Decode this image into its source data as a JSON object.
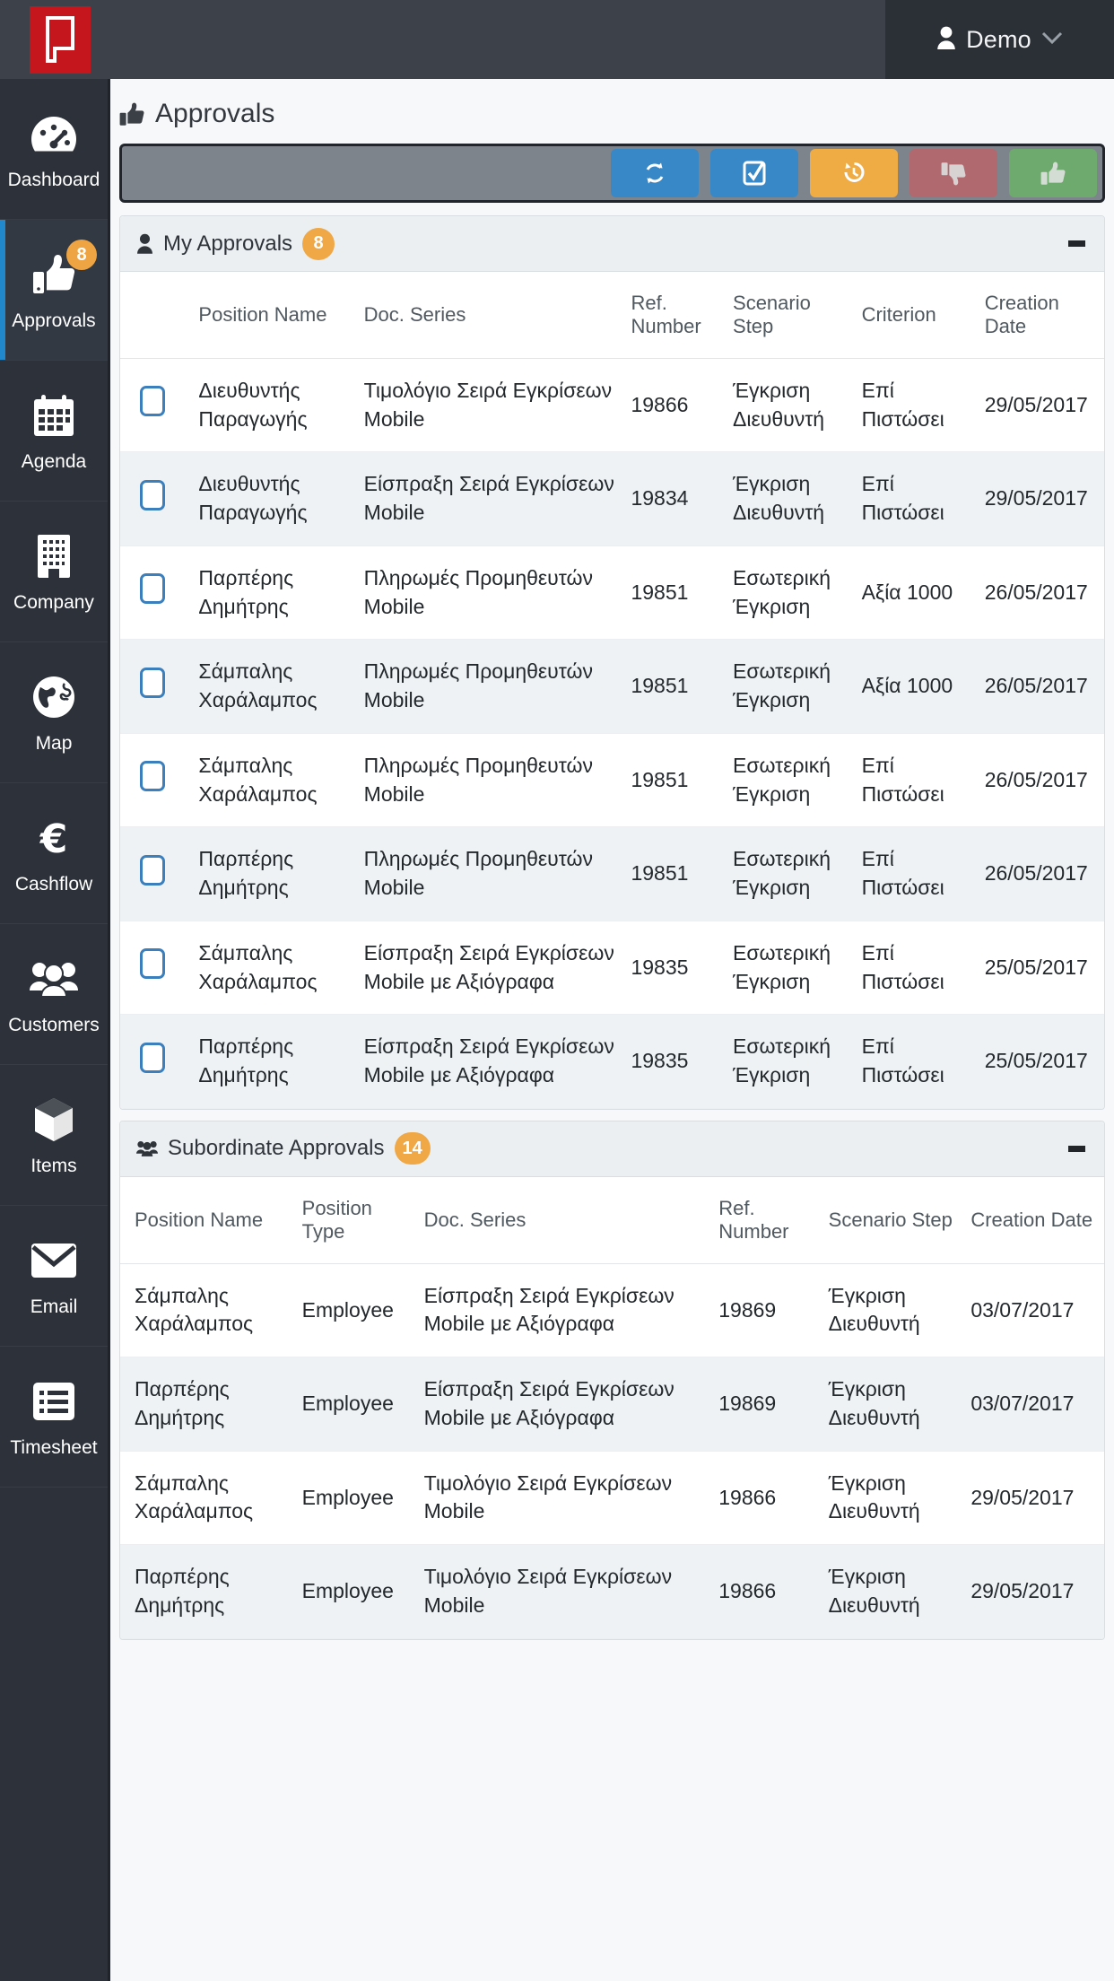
{
  "header": {
    "logo_icon": "brand-logo-icon",
    "user_icon": "user-icon",
    "user_name": "Demo",
    "caret_icon": "chevron-down-icon"
  },
  "sidebar": {
    "items": [
      {
        "label": "Dashboard",
        "icon": "dashboard-icon",
        "active": false,
        "badge": ""
      },
      {
        "label": "Approvals",
        "icon": "thumbs-up-icon",
        "active": true,
        "badge": "8"
      },
      {
        "label": "Agenda",
        "icon": "calendar-icon",
        "active": false,
        "badge": ""
      },
      {
        "label": "Company",
        "icon": "building-icon",
        "active": false,
        "badge": ""
      },
      {
        "label": "Map",
        "icon": "globe-icon",
        "active": false,
        "badge": ""
      },
      {
        "label": "Cashflow",
        "icon": "euro-icon",
        "active": false,
        "badge": ""
      },
      {
        "label": "Customers",
        "icon": "users-icon",
        "active": false,
        "badge": ""
      },
      {
        "label": "Items",
        "icon": "cube-icon",
        "active": false,
        "badge": ""
      },
      {
        "label": "Email",
        "icon": "envelope-icon",
        "active": false,
        "badge": ""
      },
      {
        "label": "Timesheet",
        "icon": "list-icon",
        "active": false,
        "badge": ""
      }
    ]
  },
  "page": {
    "title": "Approvals",
    "title_icon": "thumbs-up-icon"
  },
  "toolbar": {
    "buttons": [
      {
        "name": "refresh-button",
        "icon": "refresh-icon",
        "color": "#3888c8"
      },
      {
        "name": "select-all-button",
        "icon": "check-square-icon",
        "color": "#3888c8"
      },
      {
        "name": "history-button",
        "icon": "undo-history-icon",
        "color": "#efab44"
      },
      {
        "name": "reject-button",
        "icon": "thumbs-down-icon",
        "color": "#b0696e"
      },
      {
        "name": "approve-button",
        "icon": "thumbs-up-icon",
        "color": "#6ea96e"
      }
    ]
  },
  "my_approvals": {
    "icon": "person-icon",
    "title": "My Approvals",
    "count": "8",
    "collapse_icon": "minus-icon",
    "columns": [
      "",
      "Position Name",
      "Doc. Series",
      "Ref. Number",
      "Scenario Step",
      "Criterion",
      "Creation Date"
    ],
    "rows": [
      {
        "checked": false,
        "position": "Διευθυντής Παραγωγής",
        "doc": "Τιμολόγιο Σειρά Εγκρίσεων Mobile",
        "ref": "19866",
        "step": "Έγκριση Διευθυντή",
        "criterion": "Επί Πιστώσει",
        "date": "29/05/2017"
      },
      {
        "checked": false,
        "position": "Διευθυντής Παραγωγής",
        "doc": "Είσπραξη Σειρά Εγκρίσεων Mobile",
        "ref": "19834",
        "step": "Έγκριση Διευθυντή",
        "criterion": "Επί Πιστώσει",
        "date": "29/05/2017"
      },
      {
        "checked": false,
        "position": "Παρπέρης Δημήτρης",
        "doc": "Πληρωμές Προμηθευτών Mobile",
        "ref": "19851",
        "step": "Εσωτερική Έγκριση",
        "criterion": "Αξία 1000",
        "date": "26/05/2017"
      },
      {
        "checked": false,
        "position": "Σάμπαλης Χαράλαμπος",
        "doc": "Πληρωμές Προμηθευτών Mobile",
        "ref": "19851",
        "step": "Εσωτερική Έγκριση",
        "criterion": "Αξία 1000",
        "date": "26/05/2017"
      },
      {
        "checked": false,
        "position": "Σάμπαλης Χαράλαμπος",
        "doc": "Πληρωμές Προμηθευτών Mobile",
        "ref": "19851",
        "step": "Εσωτερική Έγκριση",
        "criterion": "Επί Πιστώσει",
        "date": "26/05/2017"
      },
      {
        "checked": false,
        "position": "Παρπέρης Δημήτρης",
        "doc": "Πληρωμές Προμηθευτών Mobile",
        "ref": "19851",
        "step": "Εσωτερική Έγκριση",
        "criterion": "Επί Πιστώσει",
        "date": "26/05/2017"
      },
      {
        "checked": false,
        "position": "Σάμπαλης Χαράλαμπος",
        "doc": "Είσπραξη Σειρά Εγκρίσεων Mobile με Αξιόγραφα",
        "ref": "19835",
        "step": "Εσωτερική Έγκριση",
        "criterion": "Επί Πιστώσει",
        "date": "25/05/2017"
      },
      {
        "checked": false,
        "position": "Παρπέρης Δημήτρης",
        "doc": "Είσπραξη Σειρά Εγκρίσεων Mobile με Αξιόγραφα",
        "ref": "19835",
        "step": "Εσωτερική Έγκριση",
        "criterion": "Επί Πιστώσει",
        "date": "25/05/2017"
      }
    ]
  },
  "subordinate_approvals": {
    "icon": "users-icon",
    "title": "Subordinate Approvals",
    "count": "14",
    "collapse_icon": "minus-icon",
    "columns": [
      "Position Name",
      "Position Type",
      "Doc. Series",
      "Ref. Number",
      "Scenario Step",
      "Creation Date"
    ],
    "rows": [
      {
        "position": "Σάμπαλης Χαράλαμπος",
        "type": "Employee",
        "doc": "Είσπραξη Σειρά Εγκρίσεων Mobile με Αξιόγραφα",
        "ref": "19869",
        "step": "Έγκριση Διευθυντή",
        "date": "03/07/2017"
      },
      {
        "position": "Παρπέρης Δημήτρης",
        "type": "Employee",
        "doc": "Είσπραξη Σειρά Εγκρίσεων Mobile με Αξιόγραφα",
        "ref": "19869",
        "step": "Έγκριση Διευθυντή",
        "date": "03/07/2017"
      },
      {
        "position": "Σάμπαλης Χαράλαμπος",
        "type": "Employee",
        "doc": "Τιμολόγιο Σειρά Εγκρίσεων Mobile",
        "ref": "19866",
        "step": "Έγκριση Διευθυντή",
        "date": "29/05/2017"
      },
      {
        "position": "Παρπέρης Δημήτρης",
        "type": "Employee",
        "doc": "Τιμολόγιο Σειρά Εγκρίσεων Mobile",
        "ref": "19866",
        "step": "Έγκριση Διευθυντή",
        "date": "29/05/2017"
      }
    ]
  },
  "colors": {
    "brand_red": "#c4161c",
    "topbar": "#3c414a",
    "topbar_dark": "#2b2f36",
    "sidebar": "#2d323a",
    "accent_blue": "#2288cc",
    "badge_orange": "#efa845"
  }
}
